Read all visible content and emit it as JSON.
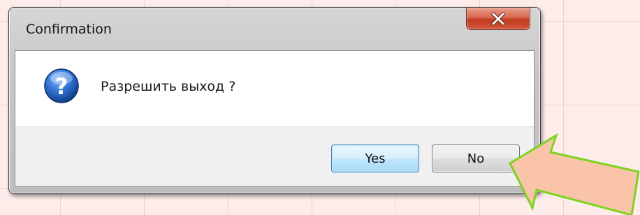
{
  "dialog": {
    "title": "Confirmation",
    "message": "Разрешить выход ?",
    "buttons": {
      "yes_label": "Yes",
      "no_label": "No"
    }
  },
  "icons": {
    "close": "close-icon",
    "question": "question-icon",
    "annotation": "arrow-icon"
  },
  "colors": {
    "background": "#fdecea",
    "close_button": "#c74b32",
    "question_icon": "#1f5fb8",
    "default_button_border": "#3c7fb1",
    "arrow_fill": "#f9c4a8",
    "arrow_outline": "#7ed321"
  }
}
